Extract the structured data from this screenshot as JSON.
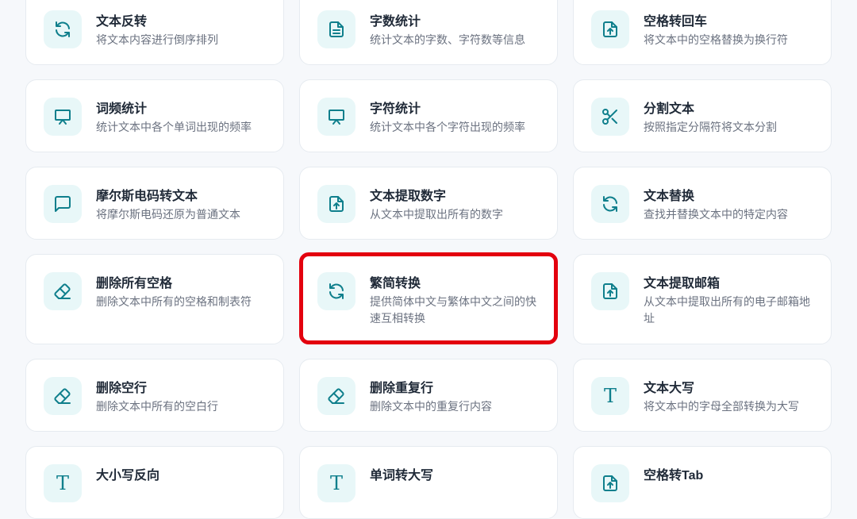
{
  "accent_color": "#0f7f8c",
  "highlight_color": "#e3000e",
  "cards": [
    {
      "title": "文本反转",
      "desc": "将文本内容进行倒序排列",
      "icon": "refresh-icon"
    },
    {
      "title": "字数统计",
      "desc": "统计文本的字数、字符数等信息",
      "icon": "document-icon"
    },
    {
      "title": "空格转回车",
      "desc": "将文本中的空格替换为换行符",
      "icon": "file-upload-icon"
    },
    {
      "title": "词频统计",
      "desc": "统计文本中各个单词出现的频率",
      "icon": "presentation-icon"
    },
    {
      "title": "字符统计",
      "desc": "统计文本中各个字符出现的频率",
      "icon": "presentation-icon"
    },
    {
      "title": "分割文本",
      "desc": "按照指定分隔符将文本分割",
      "icon": "scissors-icon"
    },
    {
      "title": "摩尔斯电码转文本",
      "desc": "将摩尔斯电码还原为普通文本",
      "icon": "chat-icon"
    },
    {
      "title": "文本提取数字",
      "desc": "从文本中提取出所有的数字",
      "icon": "file-upload-icon"
    },
    {
      "title": "文本替换",
      "desc": "查找并替换文本中的特定内容",
      "icon": "refresh-icon"
    },
    {
      "title": "删除所有空格",
      "desc": "删除文本中所有的空格和制表符",
      "icon": "eraser-icon"
    },
    {
      "title": "繁简转换",
      "desc": "提供简体中文与繁体中文之间的快速互相转换",
      "icon": "refresh-icon"
    },
    {
      "title": "文本提取邮箱",
      "desc": "从文本中提取出所有的电子邮箱地址",
      "icon": "file-upload-icon"
    },
    {
      "title": "删除空行",
      "desc": "删除文本中所有的空白行",
      "icon": "eraser-icon"
    },
    {
      "title": "删除重复行",
      "desc": "删除文本中的重复行内容",
      "icon": "eraser-icon"
    },
    {
      "title": "文本大写",
      "desc": "将文本中的字母全部转换为大写",
      "icon": "text-t-icon"
    },
    {
      "title": "大小写反向",
      "desc": "",
      "icon": "text-t-icon"
    },
    {
      "title": "单词转大写",
      "desc": "",
      "icon": "text-t-icon"
    },
    {
      "title": "空格转Tab",
      "desc": "",
      "icon": "file-upload-icon"
    }
  ]
}
